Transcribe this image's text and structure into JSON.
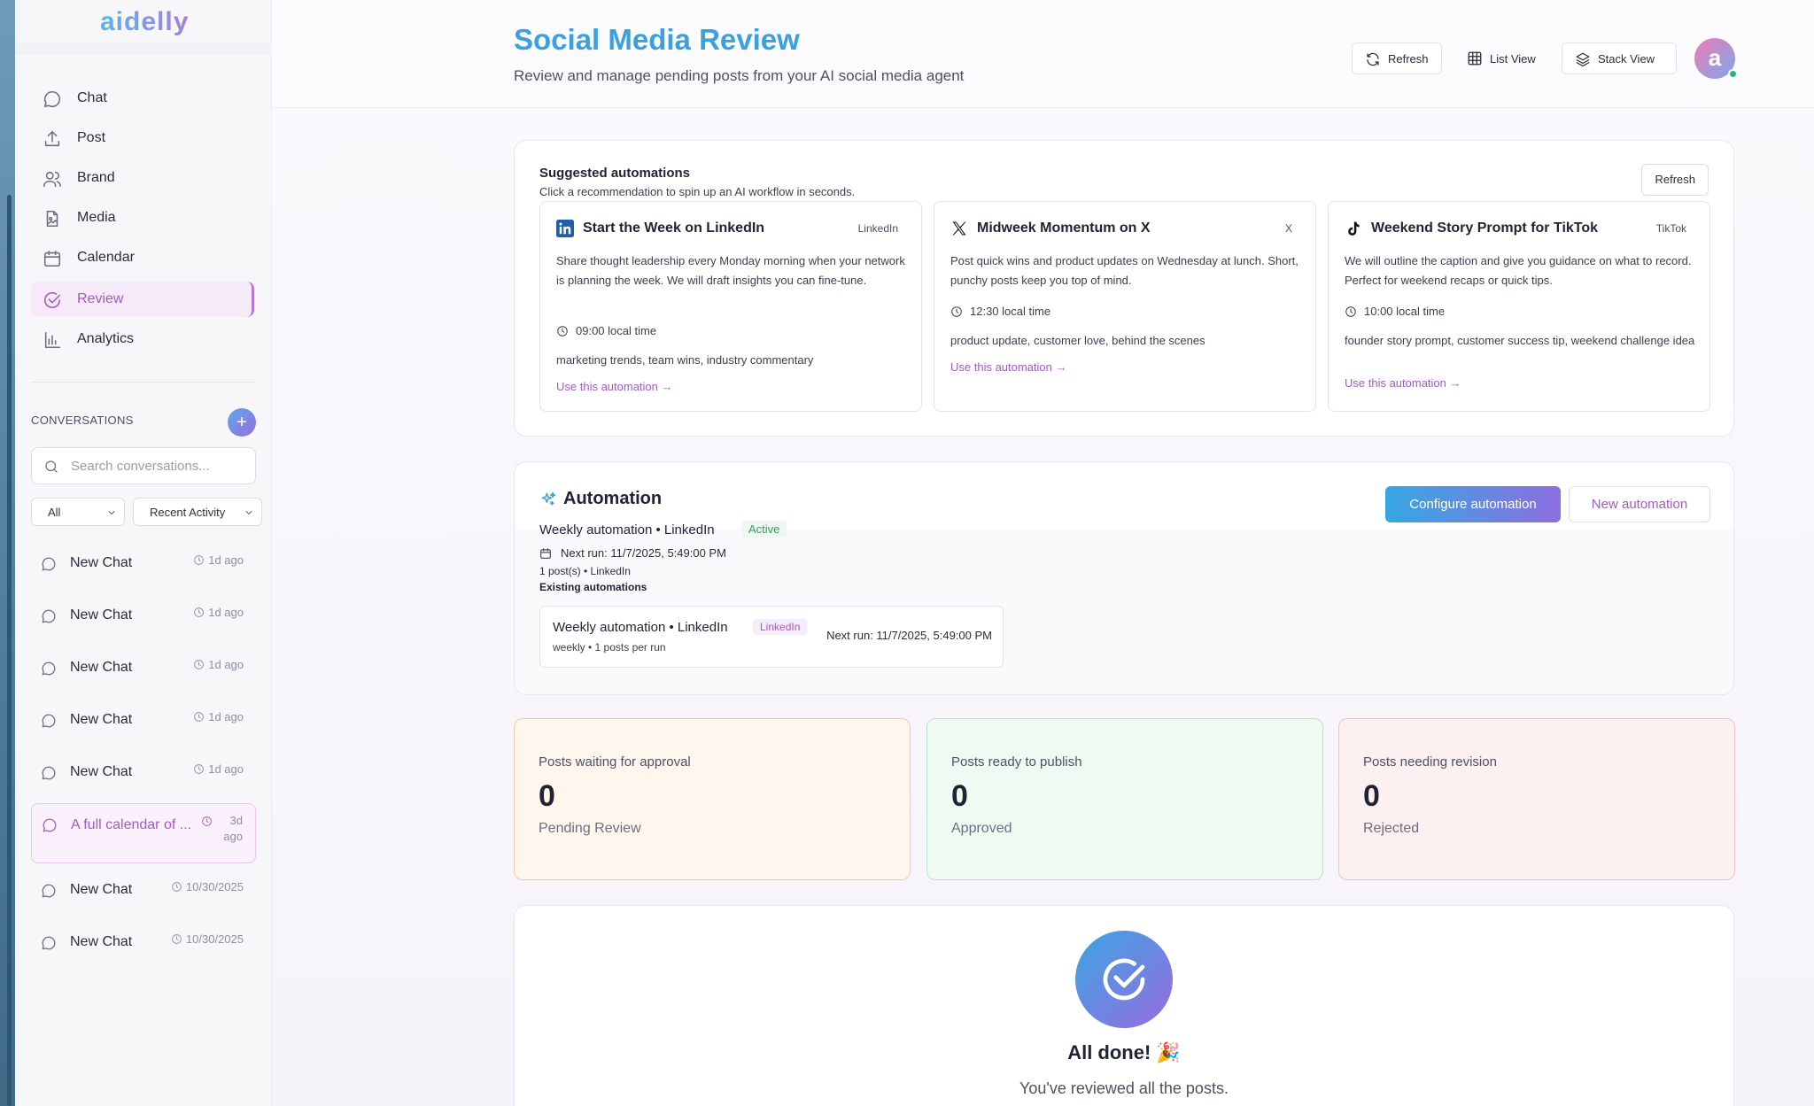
{
  "app": {
    "logo": "aidelly"
  },
  "sidebar": {
    "nav": [
      {
        "label": "Chat",
        "icon": "chat-bubble-icon"
      },
      {
        "label": "Post",
        "icon": "upload-icon"
      },
      {
        "label": "Brand",
        "icon": "users-icon"
      },
      {
        "label": "Media",
        "icon": "media-file-icon"
      },
      {
        "label": "Calendar",
        "icon": "calendar-icon"
      },
      {
        "label": "Review",
        "icon": "check-circle-icon",
        "active": true
      },
      {
        "label": "Analytics",
        "icon": "bar-chart-icon"
      }
    ],
    "conversations_title": "CONVERSATIONS",
    "add_label": "+",
    "search_placeholder": "Search conversations...",
    "filter": "All",
    "sort": "Recent Activity",
    "chats": [
      {
        "title": "New Chat",
        "time": "1d ago"
      },
      {
        "title": "New Chat",
        "time": "1d ago"
      },
      {
        "title": "New Chat",
        "time": "1d ago"
      },
      {
        "title": "New Chat",
        "time": "1d ago"
      },
      {
        "title": "New Chat",
        "time": "1d ago"
      },
      {
        "title": "A full calendar of ...",
        "time": "3d ago",
        "time_line1": "3d",
        "time_line2": "ago",
        "selected": true
      },
      {
        "title": "New Chat",
        "time": "10/30/2025"
      },
      {
        "title": "New Chat",
        "time": "10/30/2025"
      }
    ]
  },
  "header": {
    "title": "Social Media Review",
    "subtitle": "Review and manage pending posts from your AI social media agent",
    "refresh": "Refresh",
    "list_view": "List View",
    "stack_view": "Stack View",
    "avatar_letter": "a"
  },
  "suggested": {
    "title": "Suggested automations",
    "subtitle": "Click a recommendation to spin up an AI workflow in seconds.",
    "refresh": "Refresh",
    "items": [
      {
        "name": "Start the Week on LinkedIn",
        "platform": "LinkedIn",
        "icon": "linkedin-icon",
        "description": "Share thought leadership every Monday morning when your network is planning the week. We will draft insights you can fine-tune.",
        "time": "09:00 local time",
        "tags": "marketing trends, team wins, industry commentary",
        "cta": "Use this automation →"
      },
      {
        "name": "Midweek Momentum on X",
        "platform": "X",
        "icon": "x-logo-icon",
        "description": "Post quick wins and product updates on Wednesday at lunch. Short, punchy posts keep you top of mind.",
        "time": "12:30 local time",
        "tags": "product update, customer love, behind the scenes",
        "cta": "Use this automation →"
      },
      {
        "name": "Weekend Story Prompt for TikTok",
        "platform": "TikTok",
        "icon": "tiktok-icon",
        "description": "We will outline the caption and give you guidance on what to record. Perfect for weekend recaps or quick tips.",
        "time": "10:00 local time",
        "tags": "founder story prompt, customer success tip, weekend challenge idea",
        "cta": "Use this automation →"
      }
    ]
  },
  "automation": {
    "title": "Automation",
    "configure": "Configure automation",
    "new": "New automation",
    "current_name": "Weekly automation • LinkedIn",
    "status": "Active",
    "next_run": "Next run: 11/7/2025, 5:49:00 PM",
    "posts_line": "1 post(s) • LinkedIn",
    "existing_title": "Existing automations",
    "existing": [
      {
        "name": "Weekly automation • LinkedIn",
        "platform": "LinkedIn",
        "schedule": "weekly • 1 posts per run",
        "next_run": "Next run: 11/7/2025, 5:49:00 PM"
      }
    ]
  },
  "stats": [
    {
      "label": "Posts waiting for approval",
      "value": "0",
      "sub": "Pending Review",
      "bg": "#fff6ee",
      "border": "#f3cba8"
    },
    {
      "label": "Posts ready to publish",
      "value": "0",
      "sub": "Approved",
      "bg": "#eefaf2",
      "border": "#b6e6c6"
    },
    {
      "label": "Posts needing revision",
      "value": "0",
      "sub": "Rejected",
      "bg": "#fdf0f0",
      "border": "#f3c1c1"
    }
  ],
  "done": {
    "title": "All done! 🎉",
    "subtitle": "You've reviewed all the posts."
  }
}
